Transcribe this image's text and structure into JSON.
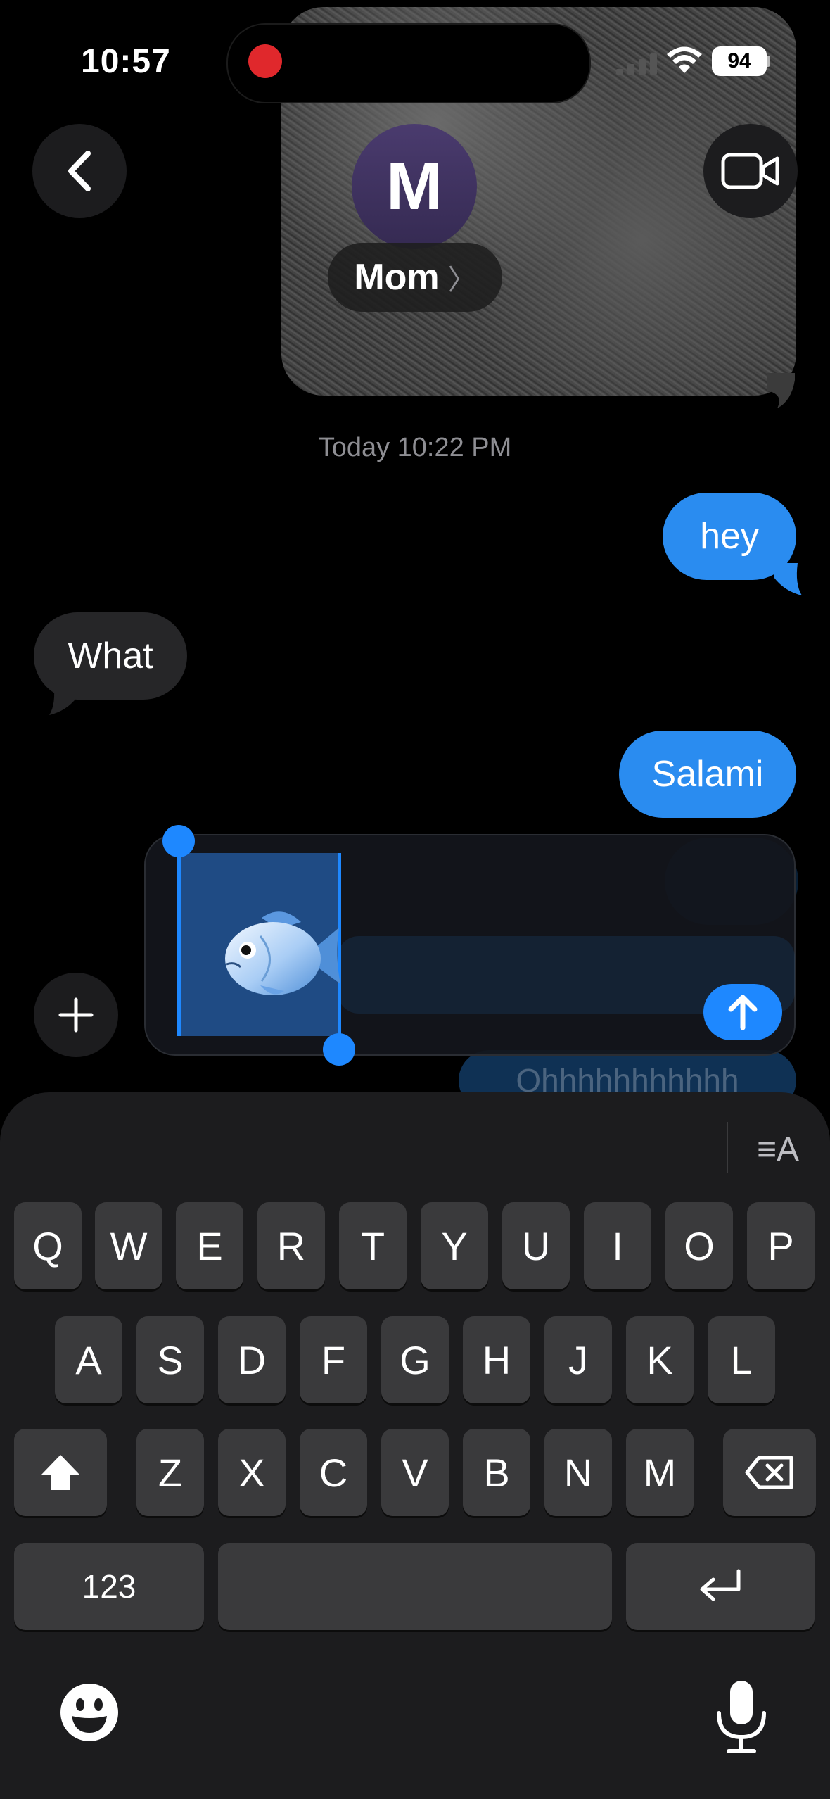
{
  "status_bar": {
    "time": "10:57",
    "battery": "94"
  },
  "conversation": {
    "contact_initial": "M",
    "contact_name": "Mom",
    "timestamp": "Today 10:22 PM"
  },
  "messages": [
    {
      "direction": "sent",
      "text": "hey"
    },
    {
      "direction": "received",
      "text": "What"
    },
    {
      "direction": "sent",
      "text": "Salami"
    }
  ],
  "background_message": "Ohhhhhhhhhhh",
  "compose": {
    "content": "🐟",
    "selected": true
  },
  "keyboard": {
    "row1": [
      "Q",
      "W",
      "E",
      "R",
      "T",
      "Y",
      "U",
      "I",
      "O",
      "P"
    ],
    "row2": [
      "A",
      "S",
      "D",
      "F",
      "G",
      "H",
      "J",
      "K",
      "L"
    ],
    "row3": [
      "Z",
      "X",
      "C",
      "V",
      "B",
      "N",
      "M"
    ],
    "numbers_label": "123"
  },
  "colors": {
    "sent_bubble": "#2a8cf0",
    "received_bubble": "#262628",
    "accent": "#1e88ff",
    "background": "#000000"
  },
  "icons": [
    "back-chevron-icon",
    "video-camera-icon",
    "plus-icon",
    "send-arrow-icon",
    "shift-icon",
    "delete-icon",
    "return-icon",
    "emoji-icon",
    "microphone-icon",
    "text-format-icon",
    "wifi-icon",
    "cellular-signal-icon",
    "record-indicator-icon"
  ]
}
